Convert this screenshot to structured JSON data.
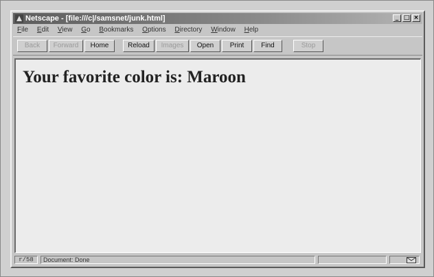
{
  "window": {
    "title": "Netscape - [file:///c|/samsnet/junk.html]",
    "minimize_glyph": "_",
    "maximize_glyph": "□",
    "close_glyph": "×"
  },
  "menu": {
    "items": [
      {
        "label": "File",
        "hotkey": "F"
      },
      {
        "label": "Edit",
        "hotkey": "E"
      },
      {
        "label": "View",
        "hotkey": "V"
      },
      {
        "label": "Go",
        "hotkey": "G"
      },
      {
        "label": "Bookmarks",
        "hotkey": "B"
      },
      {
        "label": "Options",
        "hotkey": "O"
      },
      {
        "label": "Directory",
        "hotkey": "D"
      },
      {
        "label": "Window",
        "hotkey": "W"
      },
      {
        "label": "Help",
        "hotkey": "H"
      }
    ]
  },
  "toolbar": {
    "back": "Back",
    "forward": "Forward",
    "home": "Home",
    "reload": "Reload",
    "images": "Images",
    "open": "Open",
    "print": "Print",
    "find": "Find",
    "stop": "Stop"
  },
  "page": {
    "heading": "Your favorite color is: Maroon"
  },
  "status": {
    "security_key": "r/58",
    "message": "Document: Done"
  }
}
